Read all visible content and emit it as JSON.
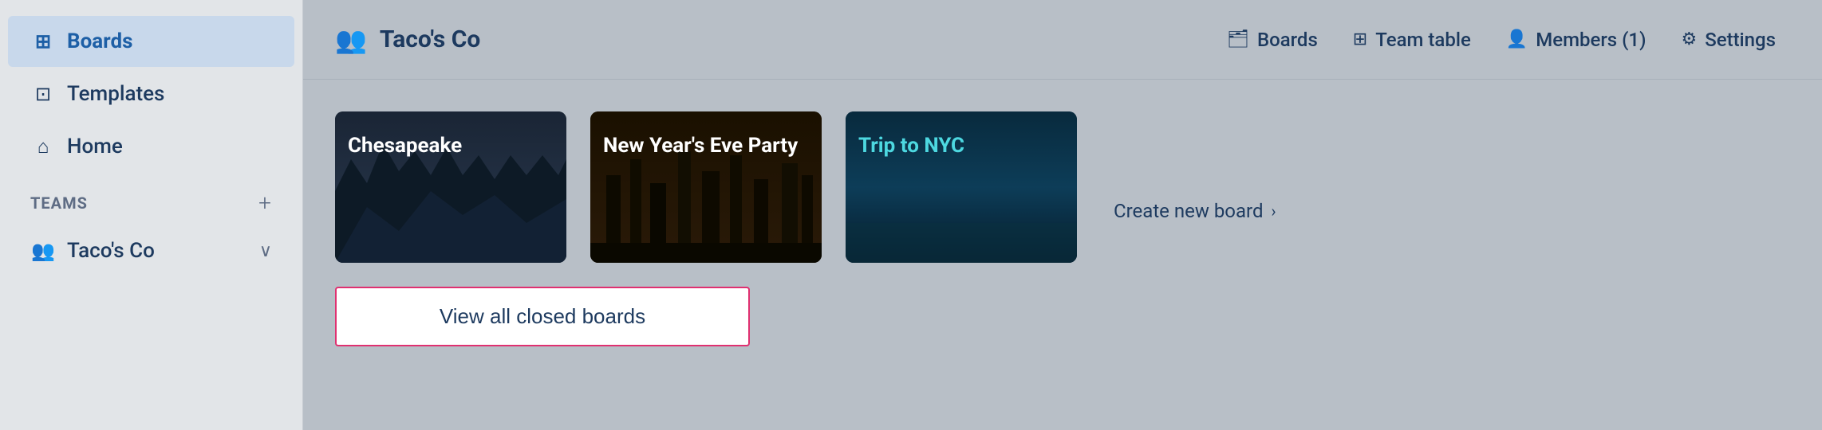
{
  "sidebar": {
    "items": [
      {
        "id": "boards",
        "label": "Boards",
        "icon": "⊞",
        "active": true
      },
      {
        "id": "templates",
        "label": "Templates",
        "icon": "⊡"
      },
      {
        "id": "home",
        "label": "Home",
        "icon": "⌂"
      }
    ],
    "teams_heading": "TEAMS",
    "teams_add_label": "+",
    "teams": [
      {
        "id": "tacos-co",
        "label": "Taco's Co",
        "icon": "👥"
      }
    ]
  },
  "topnav": {
    "workspace_icon": "👥",
    "workspace_name": "Taco's Co",
    "links": [
      {
        "id": "boards-nav",
        "icon": "🗂",
        "label": "Boards"
      },
      {
        "id": "team-table-nav",
        "icon": "⊞",
        "label": "Team table"
      },
      {
        "id": "members-nav",
        "icon": "👤",
        "label": "Members (1)"
      },
      {
        "id": "settings-nav",
        "icon": "⚙",
        "label": "Settings"
      }
    ]
  },
  "boards": [
    {
      "id": "chesapeake",
      "label": "Chesapeake",
      "bg": "chesapeake"
    },
    {
      "id": "newyear",
      "label": "New Year's Eve Party",
      "bg": "newyear"
    },
    {
      "id": "nyc",
      "label": "Trip to NYC",
      "bg": "nyc"
    }
  ],
  "create_board_label": "Create new board",
  "view_closed_label": "View all closed boards"
}
